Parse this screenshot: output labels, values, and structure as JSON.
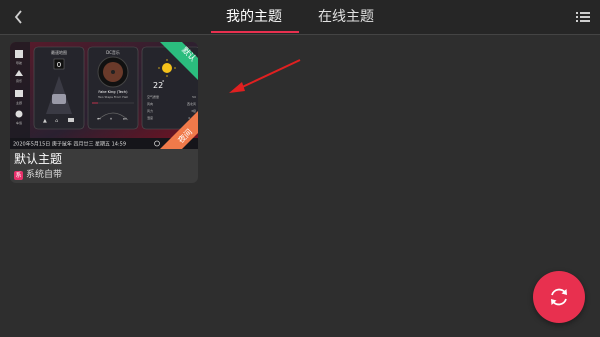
{
  "header": {
    "tabs": [
      {
        "label": "我的主题",
        "active": true
      },
      {
        "label": "在线主题",
        "active": false
      }
    ],
    "back_icon": "chevron-left-icon",
    "menu_icon": "list-menu-icon"
  },
  "theme_card": {
    "title": "默认主题",
    "source": "系统自带",
    "source_badge": "系",
    "ribbon_default": "默认",
    "ribbon_night": "夜间",
    "preview": {
      "nav_panel_title": "最速地图",
      "nav_digit": "0",
      "music_panel_title": "DC音乐",
      "song_title": "Fake King (Tech)",
      "song_artist": "Two Steps From Hell",
      "temperature": "22",
      "temp_unit": "°",
      "weather_rows": [
        {
          "label": "空气质量",
          "value": "50"
        },
        {
          "label": "风向",
          "value": "西北风"
        },
        {
          "label": "风力",
          "value": "3级"
        },
        {
          "label": "湿度",
          "value": "0.4%"
        }
      ],
      "status_bar": "2020年5月15日 庚子鼠年 四月廿三 星期五 14:59",
      "sidebar_labels": [
        "导航",
        "音乐",
        "主题",
        "车载"
      ]
    }
  },
  "colors": {
    "accent": "#e8304f",
    "ribbon_green": "#2bbd7e",
    "ribbon_orange": "#f07a4a",
    "arrow": "#e02020"
  }
}
